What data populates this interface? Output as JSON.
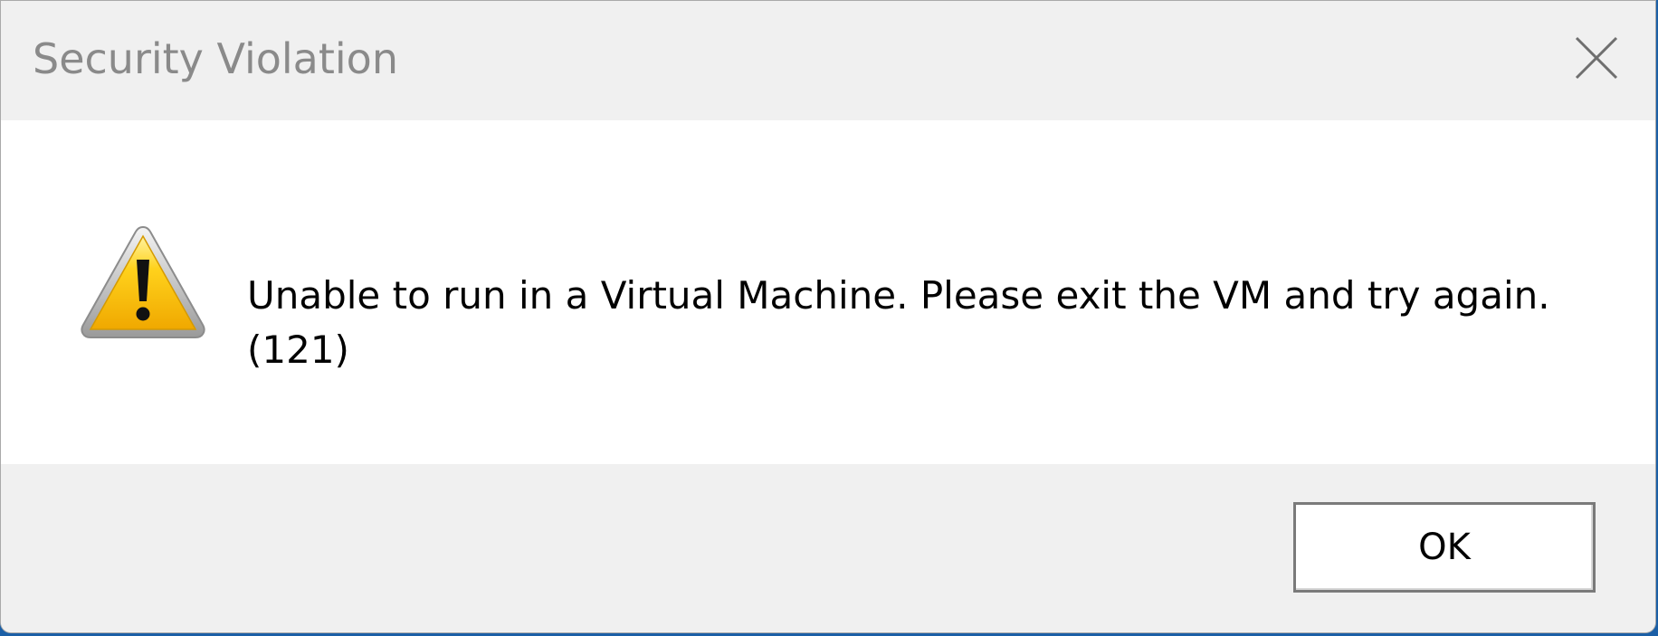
{
  "window": {
    "title": "Security Violation",
    "close_icon": "close-icon"
  },
  "dialog": {
    "icon": "warning-icon",
    "message": "Unable to run in a Virtual Machine. Please exit the VM and try again. (121)"
  },
  "buttons": {
    "ok_label": "OK"
  },
  "colors": {
    "title_text": "#8a8a8a",
    "chrome_background": "#f0f0f0",
    "content_background": "#ffffff",
    "warning_yellow": "#f5c400",
    "desktop_accent": "#1b5fa6"
  }
}
